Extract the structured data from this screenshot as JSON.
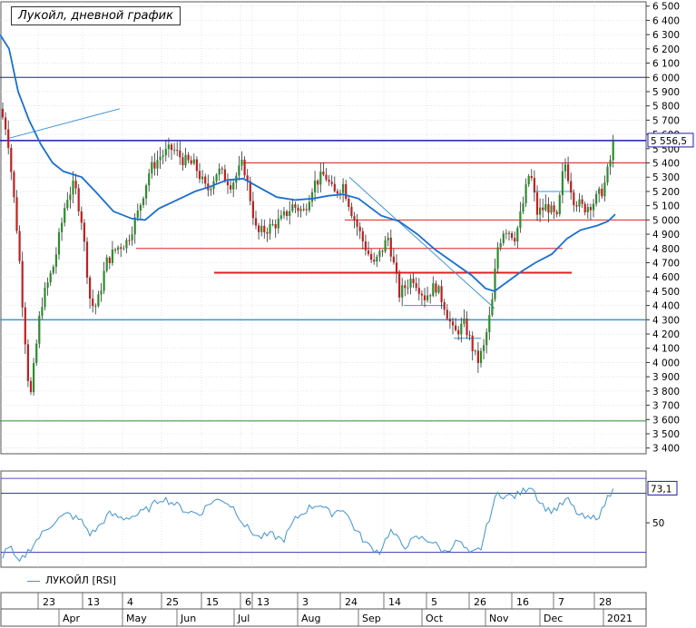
{
  "chart_data": [
    {
      "type": "candlestick",
      "title": "Лукойл, дневной график",
      "y_axis": {
        "ticks": [
          3400,
          3500,
          3600,
          3700,
          3800,
          3900,
          4000,
          4100,
          4200,
          4300,
          4400,
          4500,
          4600,
          4700,
          4800,
          4900,
          5000,
          5100,
          5200,
          5300,
          5400,
          5500,
          5600,
          5700,
          5800,
          5900,
          6000,
          6100,
          6200,
          6300,
          6400,
          6500
        ],
        "range": [
          3360,
          6530
        ],
        "position": "right"
      },
      "last_price": "5 556,5",
      "key": [
        {
          "d": 0,
          "c": 5780
        },
        {
          "d": 8,
          "c": 5620
        },
        {
          "d": 20,
          "c": 4850
        },
        {
          "d": 25,
          "c": 4400
        },
        {
          "d": 33,
          "c": 3720
        },
        {
          "d": 45,
          "c": 4400
        },
        {
          "d": 60,
          "c": 4700
        },
        {
          "d": 73,
          "c": 5150
        },
        {
          "d": 82,
          "c": 5250
        },
        {
          "d": 90,
          "c": 5000
        },
        {
          "d": 100,
          "c": 4400
        },
        {
          "d": 107,
          "c": 4400
        },
        {
          "d": 117,
          "c": 4700
        },
        {
          "d": 128,
          "c": 4800
        },
        {
          "d": 140,
          "c": 4850
        },
        {
          "d": 152,
          "c": 5050
        },
        {
          "d": 165,
          "c": 5350
        },
        {
          "d": 177,
          "c": 5450
        },
        {
          "d": 190,
          "c": 5500
        },
        {
          "d": 202,
          "c": 5420
        },
        {
          "d": 215,
          "c": 5380
        },
        {
          "d": 228,
          "c": 5200
        },
        {
          "d": 240,
          "c": 5350
        },
        {
          "d": 255,
          "c": 5250
        },
        {
          "d": 268,
          "c": 5400
        },
        {
          "d": 275,
          "c": 5180
        },
        {
          "d": 283,
          "c": 4900
        },
        {
          "d": 298,
          "c": 4950
        },
        {
          "d": 310,
          "c": 5000
        },
        {
          "d": 322,
          "c": 5100
        },
        {
          "d": 335,
          "c": 5060
        },
        {
          "d": 345,
          "c": 5250
        },
        {
          "d": 358,
          "c": 5320
        },
        {
          "d": 368,
          "c": 5180
        },
        {
          "d": 378,
          "c": 5250
        },
        {
          "d": 388,
          "c": 5050
        },
        {
          "d": 400,
          "c": 4850
        },
        {
          "d": 412,
          "c": 4680
        },
        {
          "d": 428,
          "c": 4880
        },
        {
          "d": 440,
          "c": 4480
        },
        {
          "d": 455,
          "c": 4600
        },
        {
          "d": 468,
          "c": 4460
        },
        {
          "d": 480,
          "c": 4540
        },
        {
          "d": 490,
          "c": 4400
        },
        {
          "d": 500,
          "c": 4200
        },
        {
          "d": 512,
          "c": 4270
        },
        {
          "d": 526,
          "c": 4000
        },
        {
          "d": 533,
          "c": 4100
        },
        {
          "d": 542,
          "c": 4400
        },
        {
          "d": 548,
          "c": 4800
        },
        {
          "d": 556,
          "c": 4950
        },
        {
          "d": 568,
          "c": 4880
        },
        {
          "d": 576,
          "c": 5100
        },
        {
          "d": 584,
          "c": 5350
        },
        {
          "d": 592,
          "c": 5050
        },
        {
          "d": 603,
          "c": 5100
        },
        {
          "d": 614,
          "c": 5000
        },
        {
          "d": 622,
          "c": 5420
        },
        {
          "d": 632,
          "c": 5150
        },
        {
          "d": 643,
          "c": 5080
        },
        {
          "d": 655,
          "c": 5130
        },
        {
          "d": 665,
          "c": 5220
        },
        {
          "d": 672,
          "c": 5400
        },
        {
          "d": 677,
          "c": 5556.5
        }
      ],
      "ma": [
        {
          "d": 0,
          "v": 6300
        },
        {
          "d": 10,
          "v": 6200
        },
        {
          "d": 20,
          "v": 5900
        },
        {
          "d": 32,
          "v": 5700
        },
        {
          "d": 45,
          "v": 5530
        },
        {
          "d": 58,
          "v": 5400
        },
        {
          "d": 70,
          "v": 5340
        },
        {
          "d": 90,
          "v": 5300
        },
        {
          "d": 105,
          "v": 5200
        },
        {
          "d": 125,
          "v": 5060
        },
        {
          "d": 145,
          "v": 5010
        },
        {
          "d": 160,
          "v": 5000
        },
        {
          "d": 175,
          "v": 5080
        },
        {
          "d": 195,
          "v": 5140
        },
        {
          "d": 215,
          "v": 5200
        },
        {
          "d": 230,
          "v": 5230
        },
        {
          "d": 250,
          "v": 5280
        },
        {
          "d": 268,
          "v": 5290
        },
        {
          "d": 285,
          "v": 5230
        },
        {
          "d": 305,
          "v": 5160
        },
        {
          "d": 325,
          "v": 5140
        },
        {
          "d": 345,
          "v": 5150
        },
        {
          "d": 362,
          "v": 5170
        },
        {
          "d": 378,
          "v": 5180
        },
        {
          "d": 395,
          "v": 5150
        },
        {
          "d": 420,
          "v": 5030
        },
        {
          "d": 440,
          "v": 4990
        },
        {
          "d": 460,
          "v": 4900
        },
        {
          "d": 480,
          "v": 4790
        },
        {
          "d": 500,
          "v": 4700
        },
        {
          "d": 520,
          "v": 4610
        },
        {
          "d": 535,
          "v": 4520
        },
        {
          "d": 545,
          "v": 4500
        },
        {
          "d": 560,
          "v": 4570
        },
        {
          "d": 575,
          "v": 4640
        },
        {
          "d": 590,
          "v": 4700
        },
        {
          "d": 608,
          "v": 4760
        },
        {
          "d": 625,
          "v": 4870
        },
        {
          "d": 640,
          "v": 4930
        },
        {
          "d": 658,
          "v": 4960
        },
        {
          "d": 670,
          "v": 4990
        },
        {
          "d": 678,
          "v": 5040
        }
      ],
      "levels": [
        {
          "value": 5556.5,
          "color": "#1c1caa",
          "x0": 0,
          "x1": 712,
          "width": 1.5
        },
        {
          "value": 6000,
          "color": "#1c1caa",
          "x0": 0,
          "x1": 712,
          "width": 1
        },
        {
          "value": 4300,
          "color": "#3f94d3",
          "x0": 0,
          "x1": 712,
          "width": 1.5
        },
        {
          "value": 3590,
          "color": "#2d8c2d",
          "x0": 0,
          "x1": 712,
          "width": 1
        },
        {
          "value": 5400,
          "color": "#e02020",
          "x0": 268,
          "x1": 712,
          "width": 1
        },
        {
          "value": 5000,
          "color": "#e02020",
          "x0": 380,
          "x1": 712,
          "width": 1
        },
        {
          "value": 4800,
          "color": "#e02020",
          "x0": 150,
          "x1": 620,
          "width": 1
        },
        {
          "value": 4630,
          "color": "#e02020",
          "x0": 236,
          "x1": 630,
          "width": 2
        }
      ],
      "segments": [
        {
          "x0": 8,
          "v0": 5570,
          "x1": 132,
          "v1": 5780,
          "color": "#3f94d3"
        },
        {
          "x0": 385,
          "v0": 5300,
          "x1": 545,
          "v1": 4380,
          "color": "#3f94d3"
        },
        {
          "x0": 588,
          "v0": 5200,
          "x1": 632,
          "v1": 5200,
          "color": "#3f94d3"
        },
        {
          "x0": 445,
          "v0": 4400,
          "x1": 490,
          "v1": 4400,
          "color": "#3f94d3"
        },
        {
          "x0": 500,
          "v0": 4170,
          "x1": 530,
          "v1": 4170,
          "color": "#3f94d3"
        }
      ]
    },
    {
      "type": "line",
      "series": [
        {
          "name": "ЛУКОЙЛ [RSI]"
        }
      ],
      "last_value": "73,1",
      "y_tick": "50",
      "levels": [
        80,
        70,
        30
      ],
      "y_range": [
        20,
        85
      ],
      "values": [
        {
          "d": 0,
          "v": 25
        },
        {
          "d": 10,
          "v": 35
        },
        {
          "d": 20,
          "v": 22
        },
        {
          "d": 30,
          "v": 30
        },
        {
          "d": 40,
          "v": 38
        },
        {
          "d": 50,
          "v": 45
        },
        {
          "d": 62,
          "v": 52
        },
        {
          "d": 75,
          "v": 56
        },
        {
          "d": 90,
          "v": 51
        },
        {
          "d": 100,
          "v": 42
        },
        {
          "d": 110,
          "v": 48
        },
        {
          "d": 120,
          "v": 56
        },
        {
          "d": 135,
          "v": 53
        },
        {
          "d": 150,
          "v": 55
        },
        {
          "d": 165,
          "v": 60
        },
        {
          "d": 178,
          "v": 67
        },
        {
          "d": 192,
          "v": 63
        },
        {
          "d": 205,
          "v": 58
        },
        {
          "d": 220,
          "v": 56
        },
        {
          "d": 232,
          "v": 64
        },
        {
          "d": 245,
          "v": 66
        },
        {
          "d": 258,
          "v": 60
        },
        {
          "d": 270,
          "v": 48
        },
        {
          "d": 285,
          "v": 40
        },
        {
          "d": 300,
          "v": 42
        },
        {
          "d": 312,
          "v": 38
        },
        {
          "d": 325,
          "v": 52
        },
        {
          "d": 340,
          "v": 60
        },
        {
          "d": 352,
          "v": 63
        },
        {
          "d": 364,
          "v": 56
        },
        {
          "d": 378,
          "v": 60
        },
        {
          "d": 392,
          "v": 45
        },
        {
          "d": 405,
          "v": 35
        },
        {
          "d": 418,
          "v": 30
        },
        {
          "d": 430,
          "v": 45
        },
        {
          "d": 445,
          "v": 34
        },
        {
          "d": 460,
          "v": 40
        },
        {
          "d": 475,
          "v": 38
        },
        {
          "d": 490,
          "v": 30
        },
        {
          "d": 505,
          "v": 38
        },
        {
          "d": 518,
          "v": 28
        },
        {
          "d": 530,
          "v": 33
        },
        {
          "d": 540,
          "v": 55
        },
        {
          "d": 548,
          "v": 70
        },
        {
          "d": 558,
          "v": 68
        },
        {
          "d": 568,
          "v": 68
        },
        {
          "d": 578,
          "v": 72
        },
        {
          "d": 585,
          "v": 76
        },
        {
          "d": 595,
          "v": 64
        },
        {
          "d": 605,
          "v": 58
        },
        {
          "d": 615,
          "v": 60
        },
        {
          "d": 625,
          "v": 66
        },
        {
          "d": 638,
          "v": 55
        },
        {
          "d": 650,
          "v": 52
        },
        {
          "d": 662,
          "v": 56
        },
        {
          "d": 670,
          "v": 68
        },
        {
          "d": 677,
          "v": 73.1
        }
      ]
    }
  ],
  "x_axis": {
    "days": [
      {
        "label": "23",
        "x": 42
      },
      {
        "label": "13",
        "x": 91
      },
      {
        "label": "4",
        "x": 135
      },
      {
        "label": "25",
        "x": 178
      },
      {
        "label": "15",
        "x": 222
      },
      {
        "label": "6",
        "x": 265
      },
      {
        "label": "13",
        "x": 278
      },
      {
        "label": "3",
        "x": 328
      },
      {
        "label": "24",
        "x": 375
      },
      {
        "label": "14",
        "x": 423
      },
      {
        "label": "5",
        "x": 470
      },
      {
        "label": "26",
        "x": 517
      },
      {
        "label": "16",
        "x": 564
      },
      {
        "label": "7",
        "x": 610
      },
      {
        "label": "28",
        "x": 655
      }
    ],
    "months": [
      {
        "label": "Apr",
        "x": 65
      },
      {
        "label": "May",
        "x": 135
      },
      {
        "label": "Jun",
        "x": 195
      },
      {
        "label": "Jul",
        "x": 258
      },
      {
        "label": "Aug",
        "x": 328
      },
      {
        "label": "Sep",
        "x": 395
      },
      {
        "label": "Oct",
        "x": 465
      },
      {
        "label": "Nov",
        "x": 535
      },
      {
        "label": "Dec",
        "x": 595
      },
      {
        "label": "2021",
        "x": 665
      }
    ]
  },
  "colors": {
    "up": "#2d8c2d",
    "down": "#c02020",
    "wick": "#303030",
    "ma": "#1a6fcf",
    "rsi": "#3f94d3",
    "grid": "#c8d3ea"
  }
}
